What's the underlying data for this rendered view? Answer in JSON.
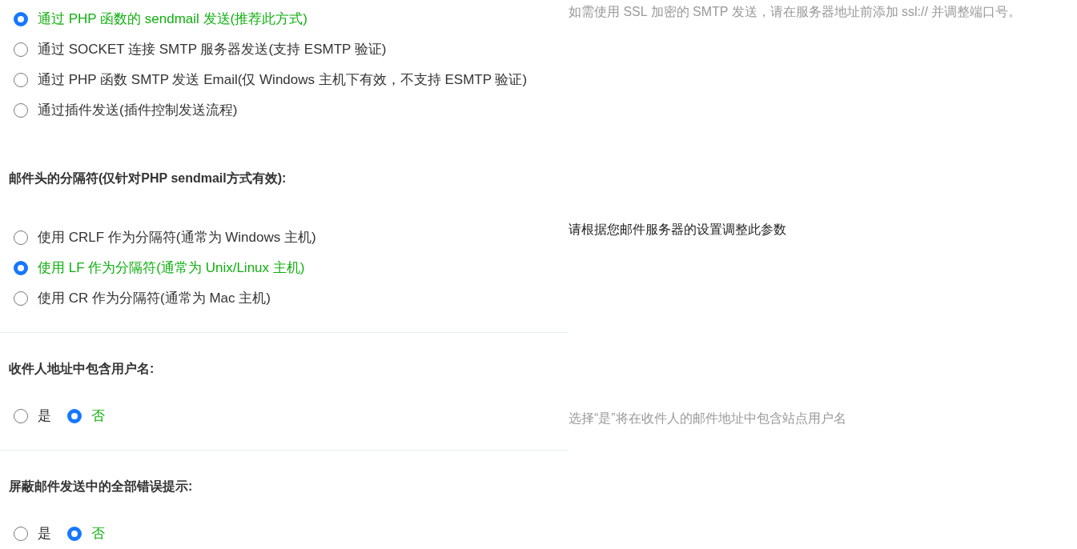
{
  "sections": [
    {
      "kind": "list",
      "options": [
        {
          "label": "通过 PHP 函数的 sendmail 发送(推荐此方式)",
          "selected": true
        },
        {
          "label": "通过 SOCKET 连接 SMTP 服务器发送(支持 ESMTP 验证)",
          "selected": false
        },
        {
          "label": "通过 PHP 函数 SMTP 发送 Email(仅 Windows 主机下有效，不支持 ESMTP 验证)",
          "selected": false
        },
        {
          "label": "通过插件发送(插件控制发送流程)",
          "selected": false
        }
      ],
      "hint": {
        "text": "如需使用 SSL 加密的 SMTP 发送，请在服务器地址前添加 ssl:// 并调整端口号。",
        "muted": true
      }
    },
    {
      "title": "邮件头的分隔符(仅针对PHP sendmail方式有效):",
      "kind": "list",
      "options": [
        {
          "label": "使用 CRLF 作为分隔符(通常为 Windows 主机)",
          "selected": false
        },
        {
          "label": "使用 LF 作为分隔符(通常为 Unix/Linux 主机)",
          "selected": true
        },
        {
          "label": "使用 CR 作为分隔符(通常为 Mac 主机)",
          "selected": false
        }
      ],
      "hint": {
        "text": "请根据您邮件服务器的设置调整此参数",
        "muted": false
      }
    },
    {
      "title": "收件人地址中包含用户名:",
      "kind": "inline",
      "options": [
        {
          "label": "是",
          "selected": false
        },
        {
          "label": "否",
          "selected": true
        }
      ],
      "hint": {
        "text": "选择“是”将在收件人的邮件地址中包含站点用户名",
        "muted": true
      }
    },
    {
      "title": "屏蔽邮件发送中的全部错误提示:",
      "kind": "inline",
      "options": [
        {
          "label": "是",
          "selected": false
        },
        {
          "label": "否",
          "selected": true
        }
      ]
    }
  ]
}
